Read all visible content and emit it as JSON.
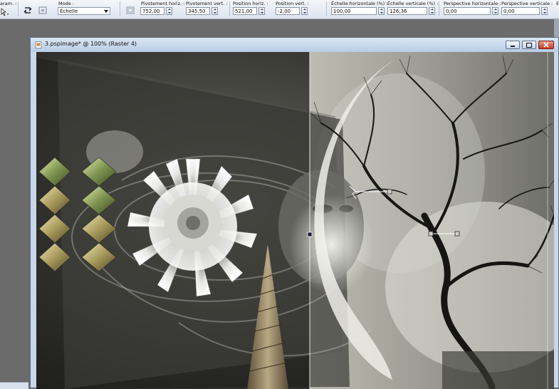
{
  "toolbar": {
    "param_label": "aram. :",
    "mode_label": "Mode :",
    "mode_value": "Échelle",
    "fields": [
      {
        "label": "Pivotement horiz. :",
        "value": "752,00"
      },
      {
        "label": "Pivotement vert. :",
        "value": "345,50"
      },
      {
        "label": "Position horiz. :",
        "value": "521,00"
      },
      {
        "label": "Position vert. :",
        "value": "-2,00"
      },
      {
        "label": "Échelle horizontale (%) :",
        "value": "100,00"
      },
      {
        "label": "Échelle verticale (%) :",
        "value": "126,36"
      },
      {
        "label": "Perspective horizontale :",
        "value": "0,00"
      },
      {
        "label": "Perspective verticale :",
        "value": "0,00"
      }
    ],
    "trailing_label": "E"
  },
  "window": {
    "title": "3.pspimage* @ 100% (Raster 4)"
  },
  "icons": {
    "reset": "reset-icon",
    "apply": "apply-icon",
    "deform": "deform-icon",
    "doc": "document-icon",
    "minimize": "minimize-icon",
    "maximize": "maximize-icon",
    "close": "close-icon"
  },
  "colors": {
    "window_frame": "#c8d7ea",
    "close_button": "#c23c24",
    "toolbar_bg": "#dde4ee"
  }
}
